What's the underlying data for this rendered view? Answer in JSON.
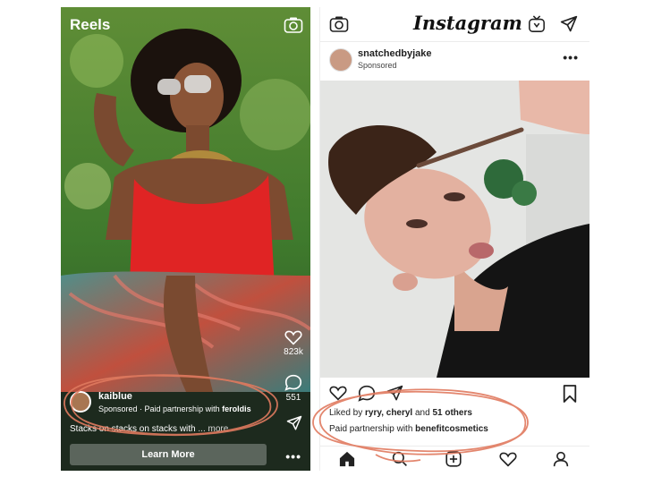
{
  "reels": {
    "title": "Reels",
    "likes_count": "823k",
    "comments_count": "551",
    "author": {
      "handle": "kaiblue",
      "sponsored_prefix": "Sponsored · Paid partnership with",
      "partner": "feroldis"
    },
    "caption": "Stacks on stacks on stacks with",
    "caption_more": "... more",
    "learn_more": "Learn More",
    "more_dots": "•••",
    "icons": [
      "camera-icon",
      "heart-icon",
      "comment-icon",
      "share-icon"
    ]
  },
  "feed": {
    "logo": "Instagram",
    "post": {
      "username": "snatchedbyjake",
      "sponsored": "Sponsored",
      "more_dots": "•••"
    },
    "liked_prefix": "Liked by",
    "liked_users": "ryry, cheryl",
    "liked_and": "and",
    "liked_count": "51 others",
    "partner_prefix": "Paid partnership with",
    "partner": "benefitcosmetics",
    "icons": [
      "camera-icon",
      "igtv-icon",
      "direct-send-icon",
      "heart-icon",
      "comment-icon",
      "share-icon",
      "bookmark-icon",
      "home-icon",
      "search-icon",
      "add-post-icon",
      "activity-heart-icon",
      "profile-icon"
    ]
  },
  "colors": {
    "annotation": "#e07a5f",
    "reels_shirt": "#e02424",
    "feed_text": "#222222"
  }
}
